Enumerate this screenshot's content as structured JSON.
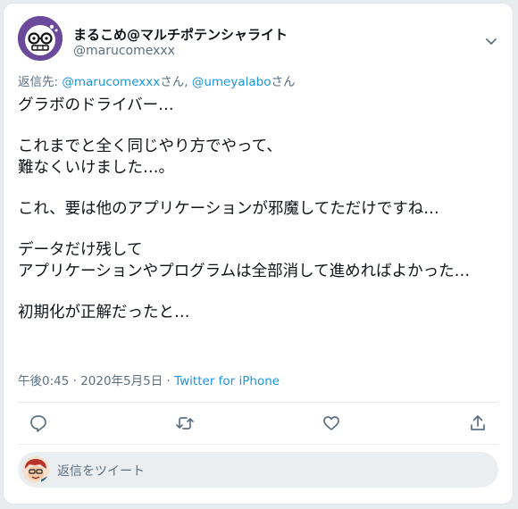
{
  "tweet": {
    "author": {
      "display_name": "まるこめ@マルチポテンシャライト",
      "handle": "@marucomexxx",
      "avatar": "avatar-glasses-face-icon"
    },
    "reply_to": {
      "prefix": "返信先: ",
      "mention1": "@marucomexxx",
      "sep1": "さん, ",
      "mention2": "@umeyalabo",
      "sep2": "さん"
    },
    "text": {
      "p1": "グラボのドライバー…",
      "p2_l1": "これまでと全く同じやり方でやって、",
      "p2_l2": "難なくいけました…。",
      "p3": "これ、要は他のアプリケーションが邪魔してただけですね…",
      "p4_l1": "データだけ残して",
      "p4_l2": "アプリケーションやプログラムは全部消して進めればよかった…",
      "p5": "初期化が正解だったと…"
    },
    "meta": {
      "time": "午後0:45",
      "dot1": " · ",
      "date": "2020年5月5日",
      "dot2": " · ",
      "source": "Twitter for iPhone"
    },
    "actions": [
      "reply-icon",
      "retweet-icon",
      "like-icon",
      "share-icon"
    ]
  },
  "reply_box": {
    "placeholder": "返信をツイート",
    "avatar": "user-avatar-icon"
  },
  "colors": {
    "accent": "#1b95e0",
    "secondary_text": "#5b7083",
    "text": "#0f1419",
    "avatar_bg": "#6b4a9c"
  }
}
